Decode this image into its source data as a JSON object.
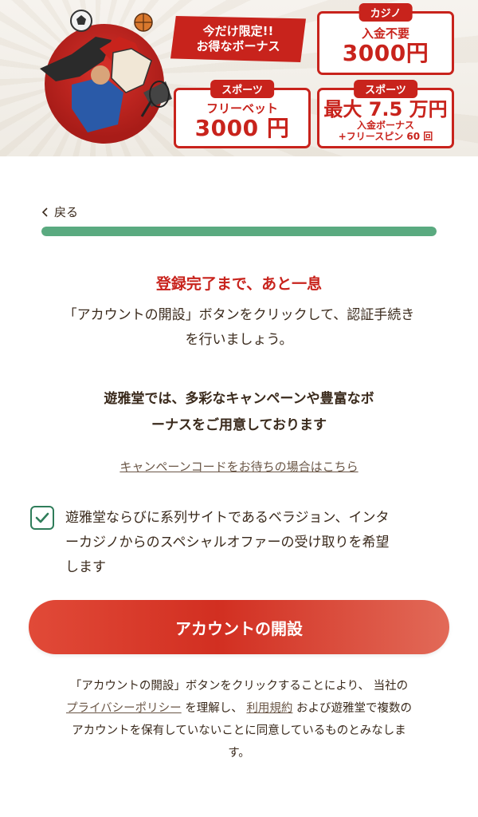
{
  "banner": {
    "ribbon_line1": "今だけ限定!!",
    "ribbon_line2": "お得なボーナス",
    "casino_card": {
      "tab": "カジノ",
      "line1": "入金不要",
      "amount": "3000円"
    },
    "sports_card_1": {
      "tab": "スポーツ",
      "line1": "フリーベット",
      "amount": "3000 円"
    },
    "sports_card_2": {
      "tab": "スポーツ",
      "line1": "最大 7.5 万円",
      "line2": "入金ボーナス",
      "line3": "+フリースピン 60 回"
    },
    "hero_icon": "sports-athletes-illustration",
    "accent_color": "#c8231c"
  },
  "nav": {
    "back_label": "戻る",
    "back_icon": "chevron-left-icon"
  },
  "progress": {
    "value": 1.0,
    "color": "#5aaa80"
  },
  "main": {
    "heading": "登録完了まで、あと一息",
    "intro_line1": "「アカウントの開設」ボタンをクリックして、認証手続き",
    "intro_line2": "を行いましょう。",
    "promo_line1": "遊雅堂では、多彩なキャンペーンや豊富なボ",
    "promo_line2": "ーナスをご用意しております",
    "campaign_link": "キャンペーンコードをお待ちの場合はこちら",
    "consent": {
      "checked": true,
      "line1": "遊雅堂ならびに系列サイトであるベラジョン、インタ",
      "line2": "ーカジノからのスペシャルオファーの受け取りを希望",
      "line3": "します"
    },
    "cta_label": "アカウントの開設"
  },
  "legal": {
    "line1": "「アカウントの開設」ボタンをクリックすることにより、 当社の",
    "privacy_link": "プライバシーポリシー",
    "text_after_privacy": " を理解し、",
    "terms_link": "利用規約",
    "text_after_terms": " および遊雅堂で複数の",
    "line3": "アカウントを保有していないことに同意しているものとみなしま",
    "line4": "す。"
  }
}
